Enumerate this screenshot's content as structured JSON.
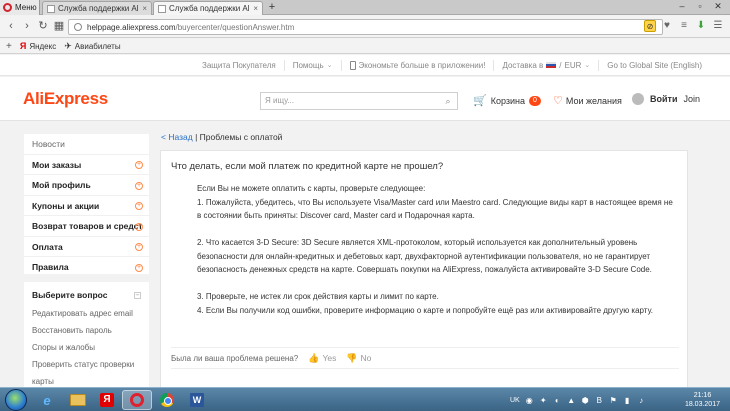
{
  "browser": {
    "menu_label": "Меню",
    "tabs": [
      {
        "label": "Служба поддержки AliExp",
        "close": "×"
      },
      {
        "label": "Служба поддержки AliEx",
        "close": "×"
      }
    ],
    "new_tab": "+",
    "url_host": "helppage.aliexpress.com",
    "url_path": "/buyercenter/questionAnswer.htm",
    "bookmarks": [
      {
        "label": "Яндекс",
        "icon": "yandex-icon"
      },
      {
        "label": "Авиабилеты",
        "icon": "plane-icon"
      }
    ]
  },
  "site": {
    "topnav": {
      "protection": "Защита Покупателя",
      "help": "Помощь",
      "app_promo": "Экономьте больше в приложении!",
      "shipping": "Доставка в",
      "currency": "EUR",
      "global": "Go to Global Site (English)"
    },
    "logo": "AliExpress",
    "search_placeholder": "Я ищу...",
    "cart_label": "Корзина",
    "cart_count": "0",
    "wishlist_label": "Мои желания",
    "signin_label": "Войти",
    "join_label": "Join"
  },
  "sidebar": {
    "news": "Новости",
    "sections": [
      {
        "label": "Мои заказы"
      },
      {
        "label": "Мой профиль"
      },
      {
        "label": "Купоны и акции"
      },
      {
        "label": "Возврат товаров и средст"
      },
      {
        "label": "Оплата"
      },
      {
        "label": "Правила"
      }
    ],
    "question_header": "Выберите вопрос",
    "links": [
      "Редактировать адрес email",
      "Восстановить пароль",
      "Споры и жалобы",
      "Проверить статус проверки",
      "карты"
    ]
  },
  "breadcrumb": {
    "back": "< Назад",
    "separator": "|",
    "current": "Проблемы с оплатой"
  },
  "article": {
    "title": "Что делать, если мой платеж по кредитной карте не прошел?",
    "lines": [
      "Если Вы не можете оплатить с карты, проверьте следующее:",
      "1. Пожалуйста, убедитесь, что Вы используете Visa/Master card или Maestro card. Следующие виды карт в настоящее время не",
      "в состоянии быть приняты: Discover card, Master card и Подарочная карта.",
      "",
      "2. Что касается 3-D Secure: 3D Secure является XML-протоколом, который используется как дополнительный уровень",
      "безопасности для онлайн-кредитных и дебетовых карт, двухфакторной аутентификации пользователя, но не гарантирует",
      "безопасность денежных средств на карте. Совершать покупки на AliExpress, пожалуйста активировайте 3-D Secure Code.",
      "",
      "3. Проверьте, не истек ли срок действия карты и лимит по карте.",
      "4. Если Вы получили код ошибки, проверите информацию о карте и попробуйте ещё раз или активировайте другую карту."
    ],
    "feedback_question": "Была ли ваша проблема решена?",
    "yes_label": "Yes",
    "no_label": "No"
  },
  "taskbar": {
    "lang": "UK",
    "time": "21:16",
    "date": "18.03.2017"
  }
}
